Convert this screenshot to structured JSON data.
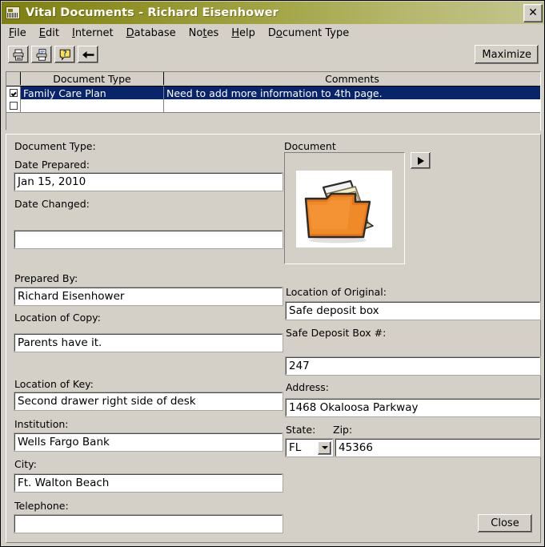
{
  "window": {
    "title": "Vital Documents - Richard Eisenhower",
    "title_icon": "app-icon",
    "close_glyph": "✕",
    "titlebar_gradient_start": "#7d7f12",
    "titlebar_gradient_end": "#c3c590",
    "face_color": "#d4d0c8",
    "selection_color": "#08246b"
  },
  "menubar": {
    "items": [
      {
        "label": "File",
        "accel": "F"
      },
      {
        "label": "Edit",
        "accel": "E"
      },
      {
        "label": "Internet",
        "accel": "I"
      },
      {
        "label": "Database",
        "accel": "D"
      },
      {
        "label": "Notes",
        "accel": "t"
      },
      {
        "label": "Help",
        "accel": "H"
      },
      {
        "label": "Document Type",
        "accel": "o"
      }
    ]
  },
  "toolbar": {
    "buttons": [
      {
        "name": "print-icon",
        "tip": "Print"
      },
      {
        "name": "print-preview-icon",
        "tip": "Print Preview"
      },
      {
        "name": "help-icon",
        "tip": "Help"
      },
      {
        "name": "back-arrow-icon",
        "tip": "Back"
      }
    ],
    "maximize_label": "Maximize"
  },
  "grid": {
    "columns": [
      "",
      "Document Type",
      "Comments"
    ],
    "rows": [
      {
        "checked": true,
        "document_type": "Family Care Plan",
        "comments": "Need to add more information to 4th page.",
        "selected": true
      },
      {
        "checked": false,
        "document_type": "",
        "comments": "",
        "selected": false
      }
    ]
  },
  "form": {
    "document_type_label": "Document Type:",
    "document_type_value": "",
    "date_prepared_label": "Date Prepared:",
    "date_prepared_value": "Jan 15, 2010",
    "date_changed_label": "Date Changed:",
    "date_changed_value": "",
    "prepared_by_label": "Prepared By:",
    "prepared_by_value": "Richard Eisenhower",
    "location_of_copy_label": "Location of Copy:",
    "location_of_copy_value": "Parents have it.",
    "location_of_key_label": "Location of Key:",
    "location_of_key_value": "Second drawer right side of desk",
    "institution_label": "Institution:",
    "institution_value": "Wells Fargo Bank",
    "city_label": "City:",
    "city_value": "Ft. Walton Beach",
    "telephone_label": "Telephone:",
    "telephone_value": "",
    "document_group_label": "Document",
    "document_preview_icon": "orange-folder-with-papers",
    "play_button_name": "view-document-button",
    "location_of_original_label": "Location of Original:",
    "location_of_original_value": "Safe deposit box",
    "safe_deposit_box_label": "Safe Deposit Box #:",
    "safe_deposit_box_value": "247",
    "address_label": "Address:",
    "address_value": "1468 Okaloosa Parkway",
    "state_label": "State:",
    "state_value": "FL",
    "zip_label": "Zip:",
    "zip_value": "45366"
  },
  "footer": {
    "close_label": "Close"
  }
}
